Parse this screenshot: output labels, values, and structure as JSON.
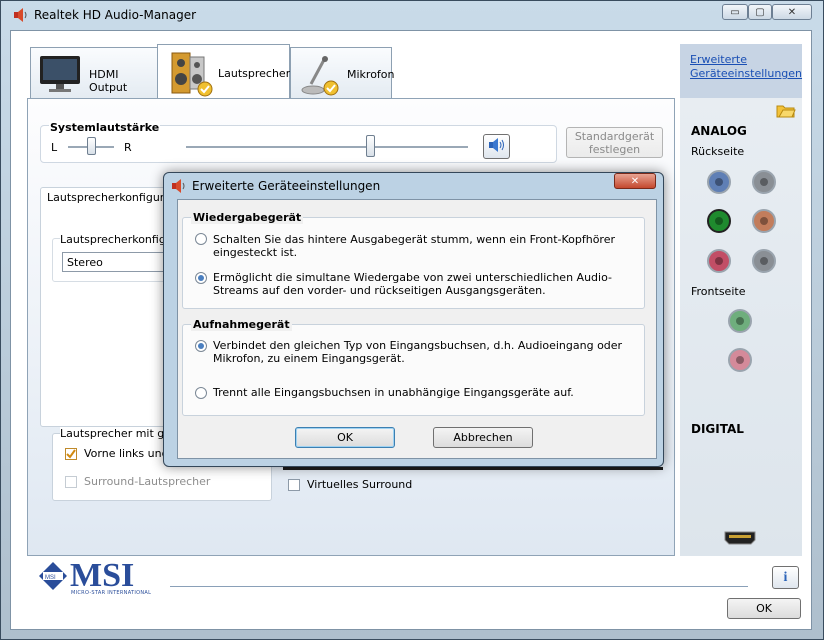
{
  "window": {
    "title": "Realtek HD Audio-Manager"
  },
  "tabs": [
    {
      "label": "HDMI Output"
    },
    {
      "label": "Lautsprecher"
    },
    {
      "label": "Mikrofon"
    }
  ],
  "volume": {
    "heading": "Systemlautstärke",
    "left": "L",
    "right": "R",
    "balance": 0.5,
    "level": 0.65,
    "default_device_button": "Standardgerät festlegen"
  },
  "speaker_config": {
    "group_label": "Lautsprecherkonfiguratio",
    "inner_label": "Lautsprecherkonfigur",
    "select_value": "Stereo"
  },
  "fullrange": {
    "group_label": "Lautsprecher mit gesa",
    "front_lr": "Vorne links und r",
    "front_lr_checked": true,
    "surround": "Surround-Lautsprecher",
    "surround_checked": false
  },
  "virtual_surround": {
    "label": "Virtuelles Surround",
    "checked": false
  },
  "right_panel": {
    "advanced_link": "Erweiterte Geräteeinstellungen",
    "analog_heading": "ANALOG",
    "rear_label": "Rückseite",
    "front_label": "Frontseite",
    "digital_heading": "DIGITAL",
    "jack_colors": {
      "blue": "#5f7fb5",
      "grey": "#8a8f95",
      "green": "#1f8a2e",
      "orange": "#c27d5c",
      "pink": "#c24e66",
      "front_green": "#6fae7d",
      "front_pink": "#d48a9a"
    }
  },
  "footer": {
    "brand": "MSI",
    "brand_sub": "MICRO-STAR INTERNATIONAL",
    "ok_button": "OK"
  },
  "dialog": {
    "title": "Erweiterte Geräteeinstellungen",
    "playback": {
      "heading": "Wiedergabegerät",
      "options": [
        {
          "text": "Schalten Sie das hintere Ausgabegerät stumm, wenn ein Front-Kopfhörer eingesteckt ist.",
          "selected": false
        },
        {
          "text": "Ermöglicht die simultane Wiedergabe von zwei unterschiedlichen Audio-Streams auf den vorder- und rückseitigen Ausgangsgeräten.",
          "selected": true
        }
      ]
    },
    "recording": {
      "heading": "Aufnahmegerät",
      "options": [
        {
          "text": "Verbindet den gleichen Typ von Eingangsbuchsen, d.h. Audioeingang oder Mikrofon, zu einem Eingangsgerät.",
          "selected": true
        },
        {
          "text": "Trennt alle Eingangsbuchsen in unabhängige Eingangsgeräte auf.",
          "selected": false
        }
      ]
    },
    "ok_button": "OK",
    "cancel_button": "Abbrechen"
  }
}
